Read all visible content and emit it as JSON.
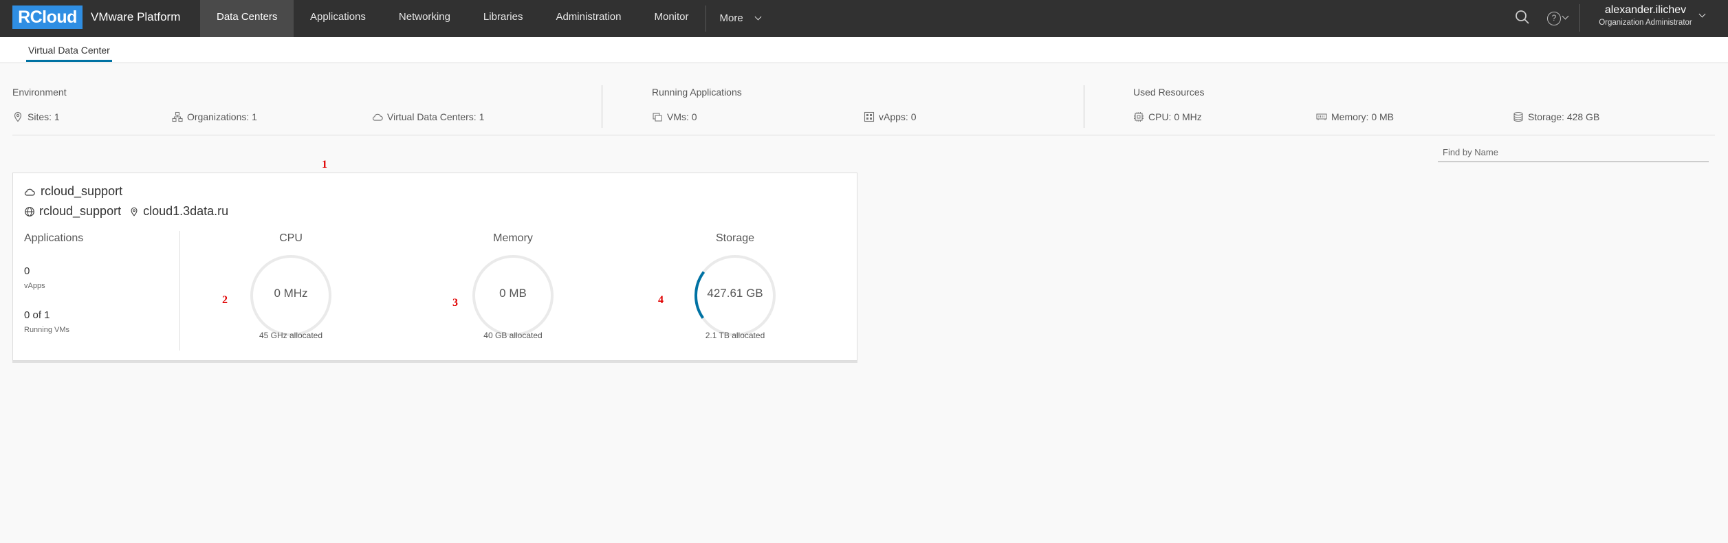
{
  "header": {
    "logo": "RCloud",
    "platform": "VMware Platform",
    "nav": [
      "Data Centers",
      "Applications",
      "Networking",
      "Libraries",
      "Administration",
      "Monitor"
    ],
    "more": "More",
    "user_name": "alexander.ilichev",
    "user_role": "Organization Administrator",
    "help_glyph": "?"
  },
  "subnav": {
    "tab": "Virtual Data Center"
  },
  "summary": {
    "environment": {
      "title": "Environment",
      "sites": "Sites:  1",
      "organizations": "Organizations:  1",
      "vdcs": "Virtual Data Centers:  1"
    },
    "running": {
      "title": "Running Applications",
      "vms": "VMs:  0",
      "vapps": "vApps:  0"
    },
    "used": {
      "title": "Used Resources",
      "cpu": "CPU:  0 MHz",
      "memory": "Memory:  0 MB",
      "storage": "Storage:  428 GB"
    }
  },
  "find": {
    "placeholder": "Find by Name"
  },
  "card": {
    "title": "rcloud_support",
    "org": "rcloud_support",
    "site": "cloud1.3data.ru",
    "applications": {
      "title": "Applications",
      "vapps_value": "0",
      "vapps_label": "vApps",
      "vms_value": "0 of 1",
      "vms_label": "Running VMs"
    },
    "cpu": {
      "title": "CPU",
      "value": "0 MHz",
      "allocated": "45 GHz allocated",
      "fraction": 0.0
    },
    "memory": {
      "title": "Memory",
      "value": "0 MB",
      "allocated": "40 GB allocated",
      "fraction": 0.0
    },
    "storage": {
      "title": "Storage",
      "value": "427.61 GB",
      "allocated": "2.1 TB allocated",
      "fraction": 0.2
    }
  },
  "markers": [
    "1",
    "2",
    "3",
    "4"
  ],
  "colors": {
    "header_bg": "#313131",
    "logo_bg": "#2f8ee3",
    "accent": "#0072a3",
    "gauge_fill": "#0072a3",
    "marker": "#e00000"
  }
}
